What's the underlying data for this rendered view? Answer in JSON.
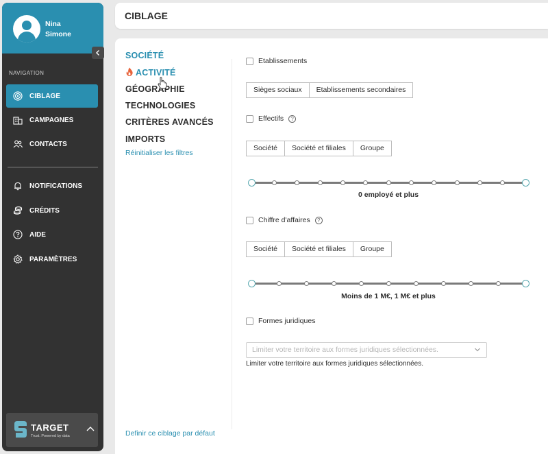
{
  "user": {
    "first_name": "Nina",
    "last_name": "Simone"
  },
  "sidebar": {
    "collapse_icon": "chevron-left-icon",
    "section_label": "NAVIGATION",
    "items": [
      {
        "label": "CIBLAGE",
        "icon": "target-icon",
        "active": true
      },
      {
        "label": "CAMPAGNES",
        "icon": "buildings-icon",
        "active": false
      },
      {
        "label": "CONTACTS",
        "icon": "users-icon",
        "active": false
      },
      {
        "label": "NOTIFICATIONS",
        "icon": "bell-icon",
        "active": false
      },
      {
        "label": "CRÉDITS",
        "icon": "coins-icon",
        "active": false
      },
      {
        "label": "AIDE",
        "icon": "help-circle-icon",
        "active": false
      },
      {
        "label": "PARAMÈTRES",
        "icon": "gear-icon",
        "active": false
      }
    ],
    "brand": {
      "name": "TARGET",
      "tagline": "Trust. Powered by data"
    }
  },
  "header": {
    "title": "CIBLAGE"
  },
  "filters_menu": {
    "items": [
      {
        "label": "SOCIÉTÉ",
        "active": true
      },
      {
        "label": "ACTIVITÉ",
        "active": true,
        "icon": "fire-icon"
      },
      {
        "label": "GÉOGRAPHIE",
        "active": false
      },
      {
        "label": "TECHNOLOGIES",
        "active": false
      },
      {
        "label": "CRITÈRES AVANCÉS",
        "active": false
      },
      {
        "label": "IMPORTS",
        "active": false
      }
    ],
    "reset_label": "Réinitialiser les filtres",
    "default_label": "Definir ce ciblage par défaut"
  },
  "form": {
    "etablissements": {
      "label": "Etablissements",
      "checked": false,
      "options": [
        "Sièges sociaux",
        "Etablissements secondaires"
      ]
    },
    "effectifs": {
      "label": "Effectifs",
      "checked": false,
      "options": [
        "Société",
        "Société et filiales",
        "Groupe"
      ],
      "slider_caption": "0 employé et plus",
      "slider_steps": 13,
      "slider_value_start": 0,
      "slider_value_end": 1
    },
    "chiffre_affaires": {
      "label": "Chiffre d'affaires",
      "checked": false,
      "options": [
        "Société",
        "Société et filiales",
        "Groupe"
      ],
      "slider_caption": "Moins de 1 M€, 1 M€ et plus",
      "slider_steps": 11,
      "slider_value_start": 0,
      "slider_value_end": 1
    },
    "formes_juridiques": {
      "label": "Formes juridiques",
      "checked": false,
      "placeholder": "Limiter votre territoire aux formes juridiques sélectionnées.",
      "help_text": "Limiter votre territoire aux formes juridiques sélectionnées."
    }
  },
  "colors": {
    "accent": "#2a8fb0",
    "sidebar_bg": "#323232",
    "fire": "#e8643c"
  }
}
